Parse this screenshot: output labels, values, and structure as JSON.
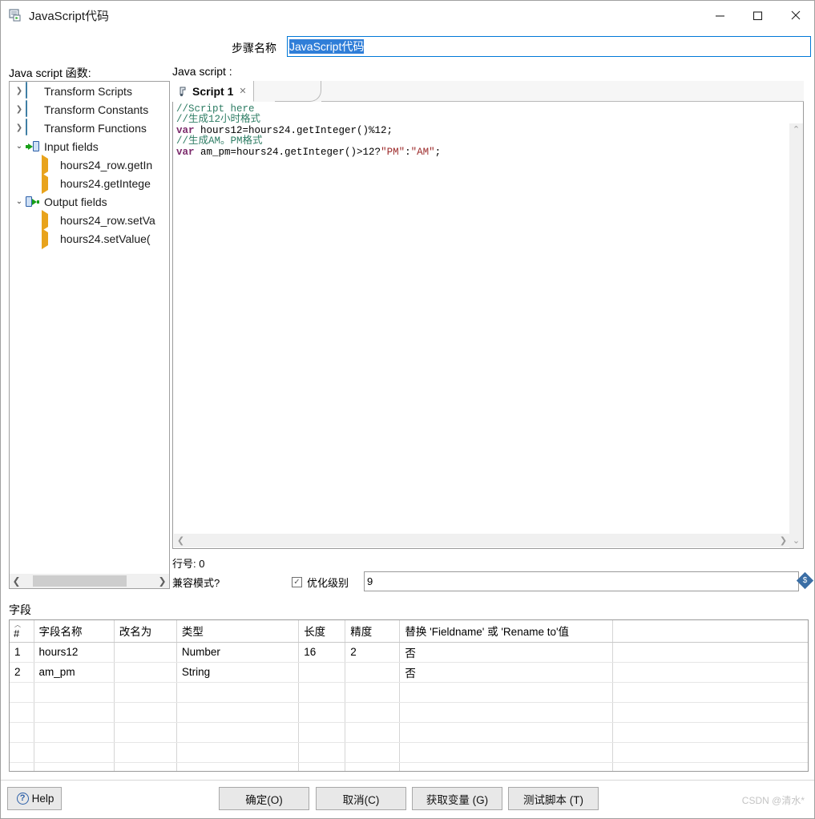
{
  "window": {
    "title": "JavaScript代码",
    "icon": "script-step-icon",
    "controls": {
      "minimize": "—",
      "maximize": "☐",
      "close": "✕"
    }
  },
  "step_name": {
    "label": "步骤名称",
    "value": "JavaScript代码",
    "selected": true
  },
  "left_panel": {
    "label": "Java script 函数:",
    "tree": [
      {
        "label": "Transform Scripts",
        "icon": "folder-icon",
        "level": 0,
        "expander": "collapsed"
      },
      {
        "label": "Transform Constants",
        "icon": "folder-icon",
        "level": 0,
        "expander": "collapsed"
      },
      {
        "label": "Transform Functions",
        "icon": "folder-icon",
        "level": 0,
        "expander": "collapsed"
      },
      {
        "label": "Input fields",
        "icon": "input-fields-icon",
        "level": 0,
        "expander": "expanded"
      },
      {
        "label": "hours24_row.getIn",
        "icon": "leaf-arrow-icon",
        "level": 1,
        "expander": "none"
      },
      {
        "label": "hours24.getIntege",
        "icon": "leaf-arrow-icon",
        "level": 1,
        "expander": "none"
      },
      {
        "label": "Output fields",
        "icon": "output-fields-icon",
        "level": 0,
        "expander": "expanded"
      },
      {
        "label": "hours24_row.setVa",
        "icon": "leaf-arrow-icon",
        "level": 1,
        "expander": "none"
      },
      {
        "label": "hours24.setValue(",
        "icon": "leaf-arrow-icon",
        "level": 1,
        "expander": "none"
      }
    ],
    "hscroll": {
      "left_arrow": "❮",
      "right_arrow": "❯"
    }
  },
  "editor": {
    "label": "Java script :",
    "tab": {
      "title": "Script 1",
      "icon": "script-icon",
      "close": "✕"
    },
    "code_lines": [
      {
        "type": "comment",
        "text": "//Script here"
      },
      {
        "type": "comment",
        "text": "//生成12小时格式"
      },
      {
        "type": "code",
        "keyword": "var",
        "rest": " hours12=hours24.getInteger()%12;"
      },
      {
        "type": "comment",
        "text": "//生成AM。PM格式"
      },
      {
        "type": "code_str",
        "keyword": "var",
        "pre": " am_pm=hours24.getInteger()>12?",
        "s1": "\"PM\"",
        "mid": ":",
        "s2": "\"AM\"",
        "post": ";"
      }
    ],
    "colors": {
      "comment": "#2e7d64",
      "keyword": "#7b2a6b",
      "string": "#9c2a2a"
    },
    "vscroll": {
      "up": "⌃",
      "down": "⌄"
    },
    "hscroll": {
      "left": "❮",
      "right": "❯"
    }
  },
  "options": {
    "row_number_label": "行号: 0",
    "compat_label": "兼容模式?",
    "optimization_checkbox": {
      "checked": true,
      "mark": "✓",
      "label": "优化级别"
    },
    "optimization_value": "9",
    "variable_icon": "variable-diamond-icon"
  },
  "fields": {
    "label": "字段",
    "columns": [
      "#",
      "字段名称",
      "改名为",
      "类型",
      "长度",
      "精度",
      "替换 'Fieldname' 或 'Rename to'值",
      ""
    ],
    "rows": [
      {
        "num": "1",
        "name": "hours12",
        "rename": "",
        "type": "Number",
        "length": "16",
        "precision": "2",
        "replace": "否",
        "last": ""
      },
      {
        "num": "2",
        "name": "am_pm",
        "rename": "",
        "type": "String",
        "length": "",
        "precision": "",
        "replace": "否",
        "last": ""
      },
      {
        "num": "",
        "name": "",
        "rename": "",
        "type": "",
        "length": "",
        "precision": "",
        "replace": "",
        "last": ""
      },
      {
        "num": "",
        "name": "",
        "rename": "",
        "type": "",
        "length": "",
        "precision": "",
        "replace": "",
        "last": ""
      },
      {
        "num": "",
        "name": "",
        "rename": "",
        "type": "",
        "length": "",
        "precision": "",
        "replace": "",
        "last": ""
      },
      {
        "num": "",
        "name": "",
        "rename": "",
        "type": "",
        "length": "",
        "precision": "",
        "replace": "",
        "last": ""
      },
      {
        "num": "",
        "name": "",
        "rename": "",
        "type": "",
        "length": "",
        "precision": "",
        "replace": "",
        "last": ""
      }
    ]
  },
  "buttons": {
    "help": "Help",
    "ok": "确定(O)",
    "cancel": "取消(C)",
    "get_variables": "获取变量 (G)",
    "test_script": "测试脚本 (T)"
  },
  "watermark": "CSDN @清水*"
}
